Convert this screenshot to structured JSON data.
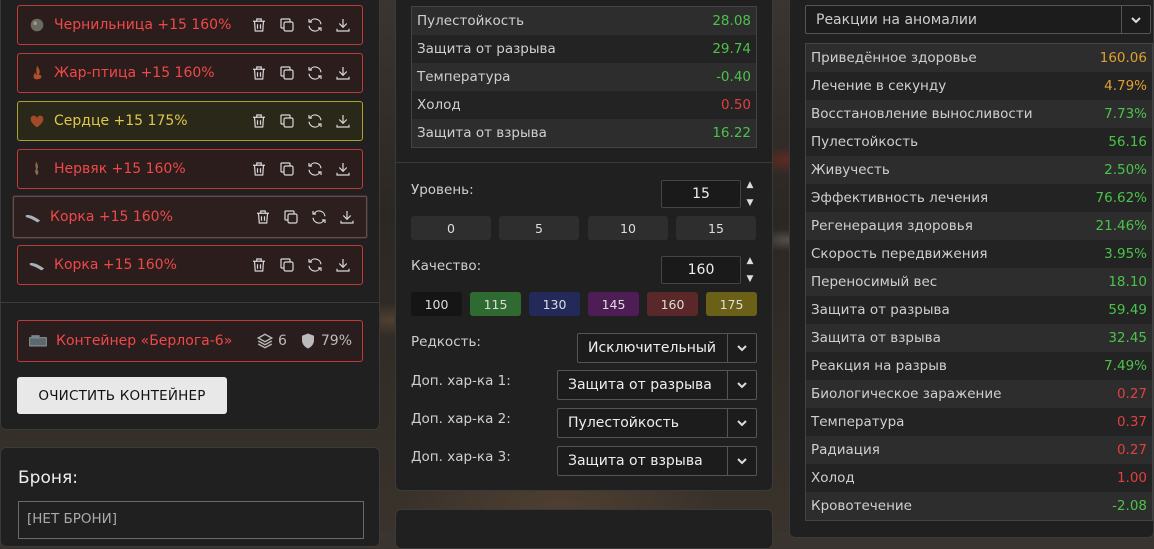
{
  "artifacts": [
    {
      "name": "Чернильница +15 160%",
      "icon": "inkwell-icon",
      "color": "red"
    },
    {
      "name": "Жар-птица +15 160%",
      "icon": "firebird-icon",
      "color": "red"
    },
    {
      "name": "Сердце +15 175%",
      "icon": "heart-icon",
      "color": "yellow"
    },
    {
      "name": "Нервяк +15 160%",
      "icon": "nervyak-icon",
      "color": "red"
    },
    {
      "name": "Корка +15 160%",
      "icon": "crust-icon",
      "color": "red"
    },
    {
      "name": "Корка +15 160%",
      "icon": "crust-icon",
      "color": "red"
    }
  ],
  "container": {
    "name": "Контейнер «Берлога-6»",
    "slots": "6",
    "protection": "79%"
  },
  "clear_button": "ОЧИСТИТЬ КОНТЕЙНЕР",
  "armor": {
    "title": "Броня:",
    "value": "[НЕТ БРОНИ]"
  },
  "mid_stats": [
    {
      "label": "Пулестойкость",
      "value": "28.08",
      "tone": "pos"
    },
    {
      "label": "Защита от разрыва",
      "value": "29.74",
      "tone": "pos"
    },
    {
      "label": "Температура",
      "value": "-0.40",
      "tone": "pos"
    },
    {
      "label": "Холод",
      "value": "0.50",
      "tone": "neg"
    },
    {
      "label": "Защита от взрыва",
      "value": "16.22",
      "tone": "pos"
    }
  ],
  "level": {
    "label": "Уровень:",
    "value": "15",
    "presets": [
      "0",
      "5",
      "10",
      "15"
    ]
  },
  "quality": {
    "label": "Качество:",
    "value": "160",
    "presets": [
      {
        "v": "100",
        "bg": "#151515"
      },
      {
        "v": "115",
        "bg": "#2f6b30"
      },
      {
        "v": "130",
        "bg": "#232a5a"
      },
      {
        "v": "145",
        "bg": "#4e1d55"
      },
      {
        "v": "160",
        "bg": "#5a2828"
      },
      {
        "v": "175",
        "bg": "#6b6018"
      }
    ]
  },
  "rarity": {
    "label": "Редкость:",
    "value": "Исключительный"
  },
  "extra1": {
    "label": "Доп. хар-ка 1:",
    "value": "Защита от разрыва"
  },
  "extra2": {
    "label": "Доп. хар-ка 2:",
    "value": "Пулестойкость"
  },
  "extra3": {
    "label": "Доп. хар-ка 3:",
    "value": "Защита от взрыва"
  },
  "right_dropdown": "Реакции на аномалии",
  "right_stats": [
    {
      "label": "Приведённое здоровье",
      "value": "160.06",
      "tone": "warn"
    },
    {
      "label": "Лечение в секунду",
      "value": "4.79%",
      "tone": "warn"
    },
    {
      "label": "Восстановление выносливости",
      "value": "7.73%",
      "tone": "pos"
    },
    {
      "label": "Пулестойкость",
      "value": "56.16",
      "tone": "pos"
    },
    {
      "label": "Живучесть",
      "value": "2.50%",
      "tone": "pos"
    },
    {
      "label": "Эффективность лечения",
      "value": "76.62%",
      "tone": "pos"
    },
    {
      "label": "Регенерация здоровья",
      "value": "21.46%",
      "tone": "pos"
    },
    {
      "label": "Скорость передвижения",
      "value": "3.95%",
      "tone": "pos"
    },
    {
      "label": "Переносимый вес",
      "value": "18.10",
      "tone": "pos"
    },
    {
      "label": "Защита от разрыва",
      "value": "59.49",
      "tone": "pos"
    },
    {
      "label": "Защита от взрыва",
      "value": "32.45",
      "tone": "pos"
    },
    {
      "label": "Реакция на разрыв",
      "value": "7.49%",
      "tone": "pos"
    },
    {
      "label": "Биологическое заражение",
      "value": "0.27",
      "tone": "neg"
    },
    {
      "label": "Температура",
      "value": "0.37",
      "tone": "neg"
    },
    {
      "label": "Радиация",
      "value": "0.27",
      "tone": "neg"
    },
    {
      "label": "Холод",
      "value": "1.00",
      "tone": "neg"
    },
    {
      "label": "Кровотечение",
      "value": "-2.08",
      "tone": "pos"
    }
  ]
}
